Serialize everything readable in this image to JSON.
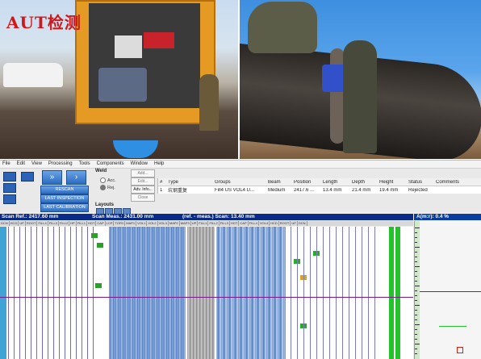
{
  "photo_title": "AUT检测",
  "menu": [
    "File",
    "Edit",
    "View",
    "Processing",
    "Tools",
    "Components",
    "Window",
    "Help"
  ],
  "toolbar": {
    "rescan_label": "RESCAN",
    "last_inspection_label": "LAST INSPECTION",
    "last_calibration_label": "LAST CALIBRATION",
    "weld_label": "Weld",
    "radio_acc": "Acc.",
    "radio_rej": "Rej.",
    "btn_add": "Add...",
    "btn_edit": "Edit...",
    "btn_adv_info": "Adv. Info...",
    "btn_close": "Close",
    "layouts_label": "Layouts"
  },
  "results_table": {
    "headers": [
      "#",
      "Type",
      "Groups",
      "Beam",
      "Position",
      "Length",
      "Depth",
      "Height",
      "Status",
      "Comments"
    ],
    "rows": [
      [
        "1",
        "坑钢重复",
        "Fill4 US  VOL4 U...",
        "Medium",
        "2417.6 ...",
        "13.4 mm",
        "21.4 mm",
        "19.4 mm",
        "Rejected",
        ""
      ]
    ]
  },
  "scan_bar": {
    "ref": "Scan Ref.: 2417.60 mm",
    "meas": "Scan Meas.: 2431.00 mm",
    "diff": "(ref. - meas.) Scan: 13.40 mm",
    "amp": "A(m:r): 0.4 %"
  },
  "channel_labels": [
    "DCN",
    "HCD",
    "UP",
    "ROOT",
    "FILL4",
    "FILL3",
    "FILL2",
    "HP",
    "FILL1",
    "HOT",
    "CAP",
    "LCP",
    "TOFD",
    "MAP1",
    "VOL1",
    "VOL2",
    "VOL3",
    "MAP2",
    "MAP3",
    "UP",
    "FILL1",
    "FILL2",
    "FILL3",
    "HOT",
    "CAP",
    "FILL4",
    "VOL4",
    "HCD",
    "ROOT",
    "UP",
    "DCN"
  ],
  "colors": {
    "title_red": "#d1171b",
    "bar_navy": "#0a2a8a",
    "button_blue": "#2c6bc1",
    "indication_green": "#22c22a",
    "cursor_purple": "#7a1a8a",
    "tofd_blue": "#5d86c8"
  },
  "icons": [
    "photo-truck",
    "photo-pipe",
    "scan-icon",
    "chevron-right-icon"
  ]
}
